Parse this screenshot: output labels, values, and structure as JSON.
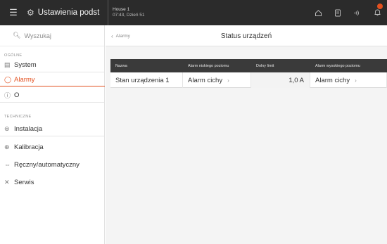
{
  "topbar": {
    "menu_icon": "hamburger-icon",
    "title": "Ustawienia podst",
    "house_name": "House 1",
    "house_time": "07:43, Dzień 51",
    "icons": [
      "home-icon",
      "notes-icon",
      "signal-icon",
      "bell-icon"
    ],
    "accent": "#e3501f"
  },
  "sidebar": {
    "search_placeholder": "Wyszukaj",
    "section_general": "OGÓLNE",
    "items_general": [
      {
        "label": "System",
        "icon": "system-icon"
      },
      {
        "label": "Alarmy",
        "icon": "alarm-icon",
        "active": true
      },
      {
        "label": "O",
        "icon": "info-icon"
      }
    ],
    "section_technical": "TECHNICZNE",
    "items_technical": [
      {
        "label": "Instalacja",
        "icon": "installation-icon"
      },
      {
        "label": "Kalibracja",
        "icon": "calibration-icon"
      },
      {
        "label": "Ręczny/automatyczny",
        "icon": "manual-auto-icon"
      },
      {
        "label": "Serwis",
        "icon": "service-icon"
      }
    ]
  },
  "main": {
    "back_label": "Alarmy",
    "title": "Status urządzeń",
    "table": {
      "headers": [
        "Nazwa",
        "Alarm niskiego poziomu",
        "Dolny limit",
        "Alarm wysokiego poziomu"
      ],
      "rows": [
        {
          "name": "Stan urządzenia 1",
          "low_alarm": "Alarm cichy",
          "low_limit": "1,0 A",
          "high_alarm": "Alarm cichy"
        }
      ]
    }
  }
}
